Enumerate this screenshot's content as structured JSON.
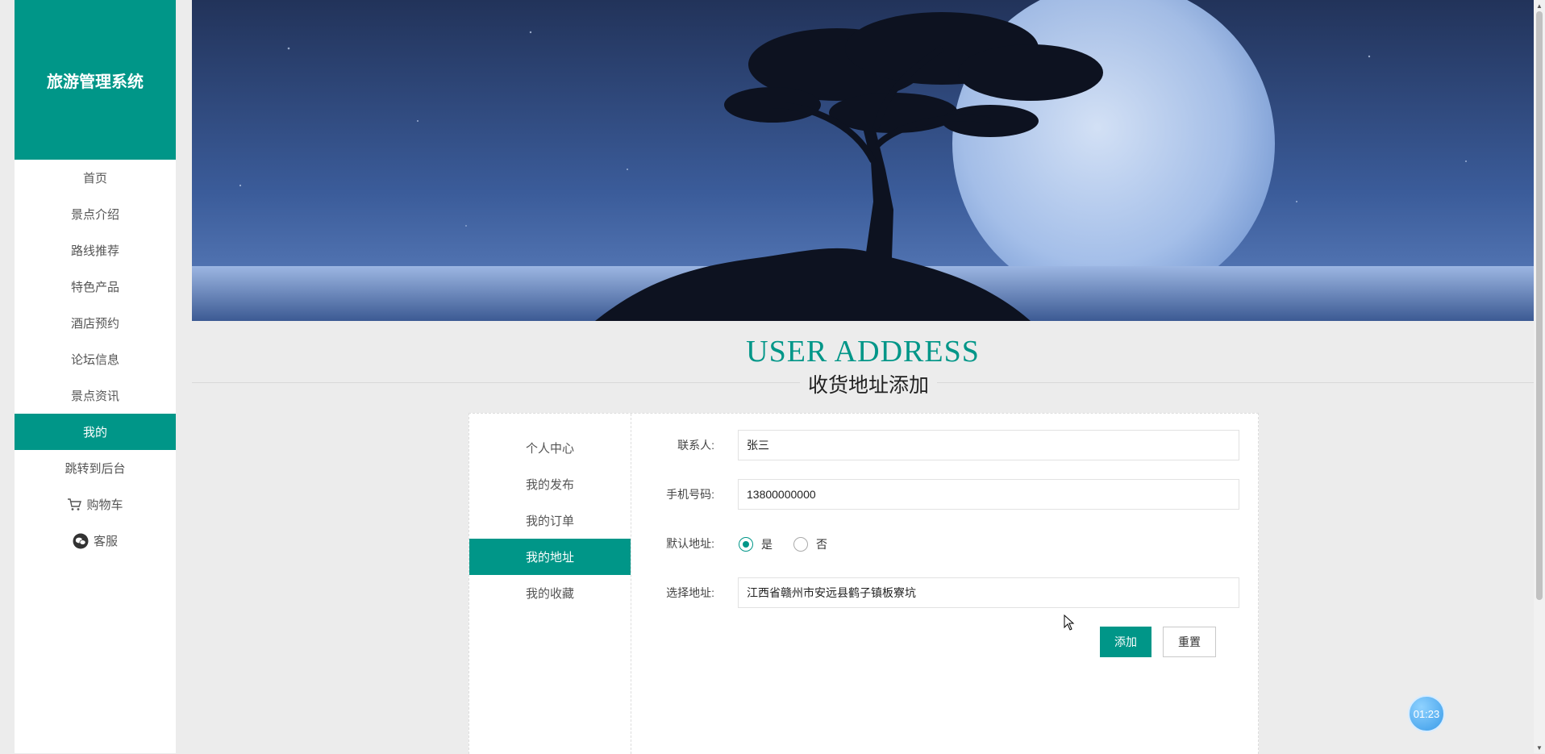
{
  "app": {
    "title": "旅游管理系统"
  },
  "sidebar": {
    "items": [
      {
        "label": "首页"
      },
      {
        "label": "景点介绍"
      },
      {
        "label": "路线推荐"
      },
      {
        "label": "特色产品"
      },
      {
        "label": "酒店预约"
      },
      {
        "label": "论坛信息"
      },
      {
        "label": "景点资讯"
      },
      {
        "label": "我的",
        "active": true
      },
      {
        "label": "跳转到后台"
      },
      {
        "label": "购物车",
        "icon": "cart-icon"
      },
      {
        "label": "客服",
        "icon": "chat-icon"
      }
    ]
  },
  "page": {
    "title_en": "USER ADDRESS",
    "title_cn": "收货地址添加"
  },
  "subnav": {
    "items": [
      {
        "label": "个人中心"
      },
      {
        "label": "我的发布"
      },
      {
        "label": "我的订单"
      },
      {
        "label": "我的地址",
        "active": true
      },
      {
        "label": "我的收藏"
      }
    ]
  },
  "form": {
    "contact_label": "联系人:",
    "contact_value": "张三",
    "phone_label": "手机号码:",
    "phone_value": "13800000000",
    "default_label": "默认地址:",
    "default_options": [
      "是",
      "否"
    ],
    "default_selected": "是",
    "address_label": "选择地址:",
    "address_value": "江西省赣州市安远县鹤子镇板寮坑",
    "add_button": "添加",
    "reset_button": "重置"
  },
  "timer": {
    "text": "01:23"
  },
  "colors": {
    "accent": "#009688",
    "background": "#ececec"
  }
}
